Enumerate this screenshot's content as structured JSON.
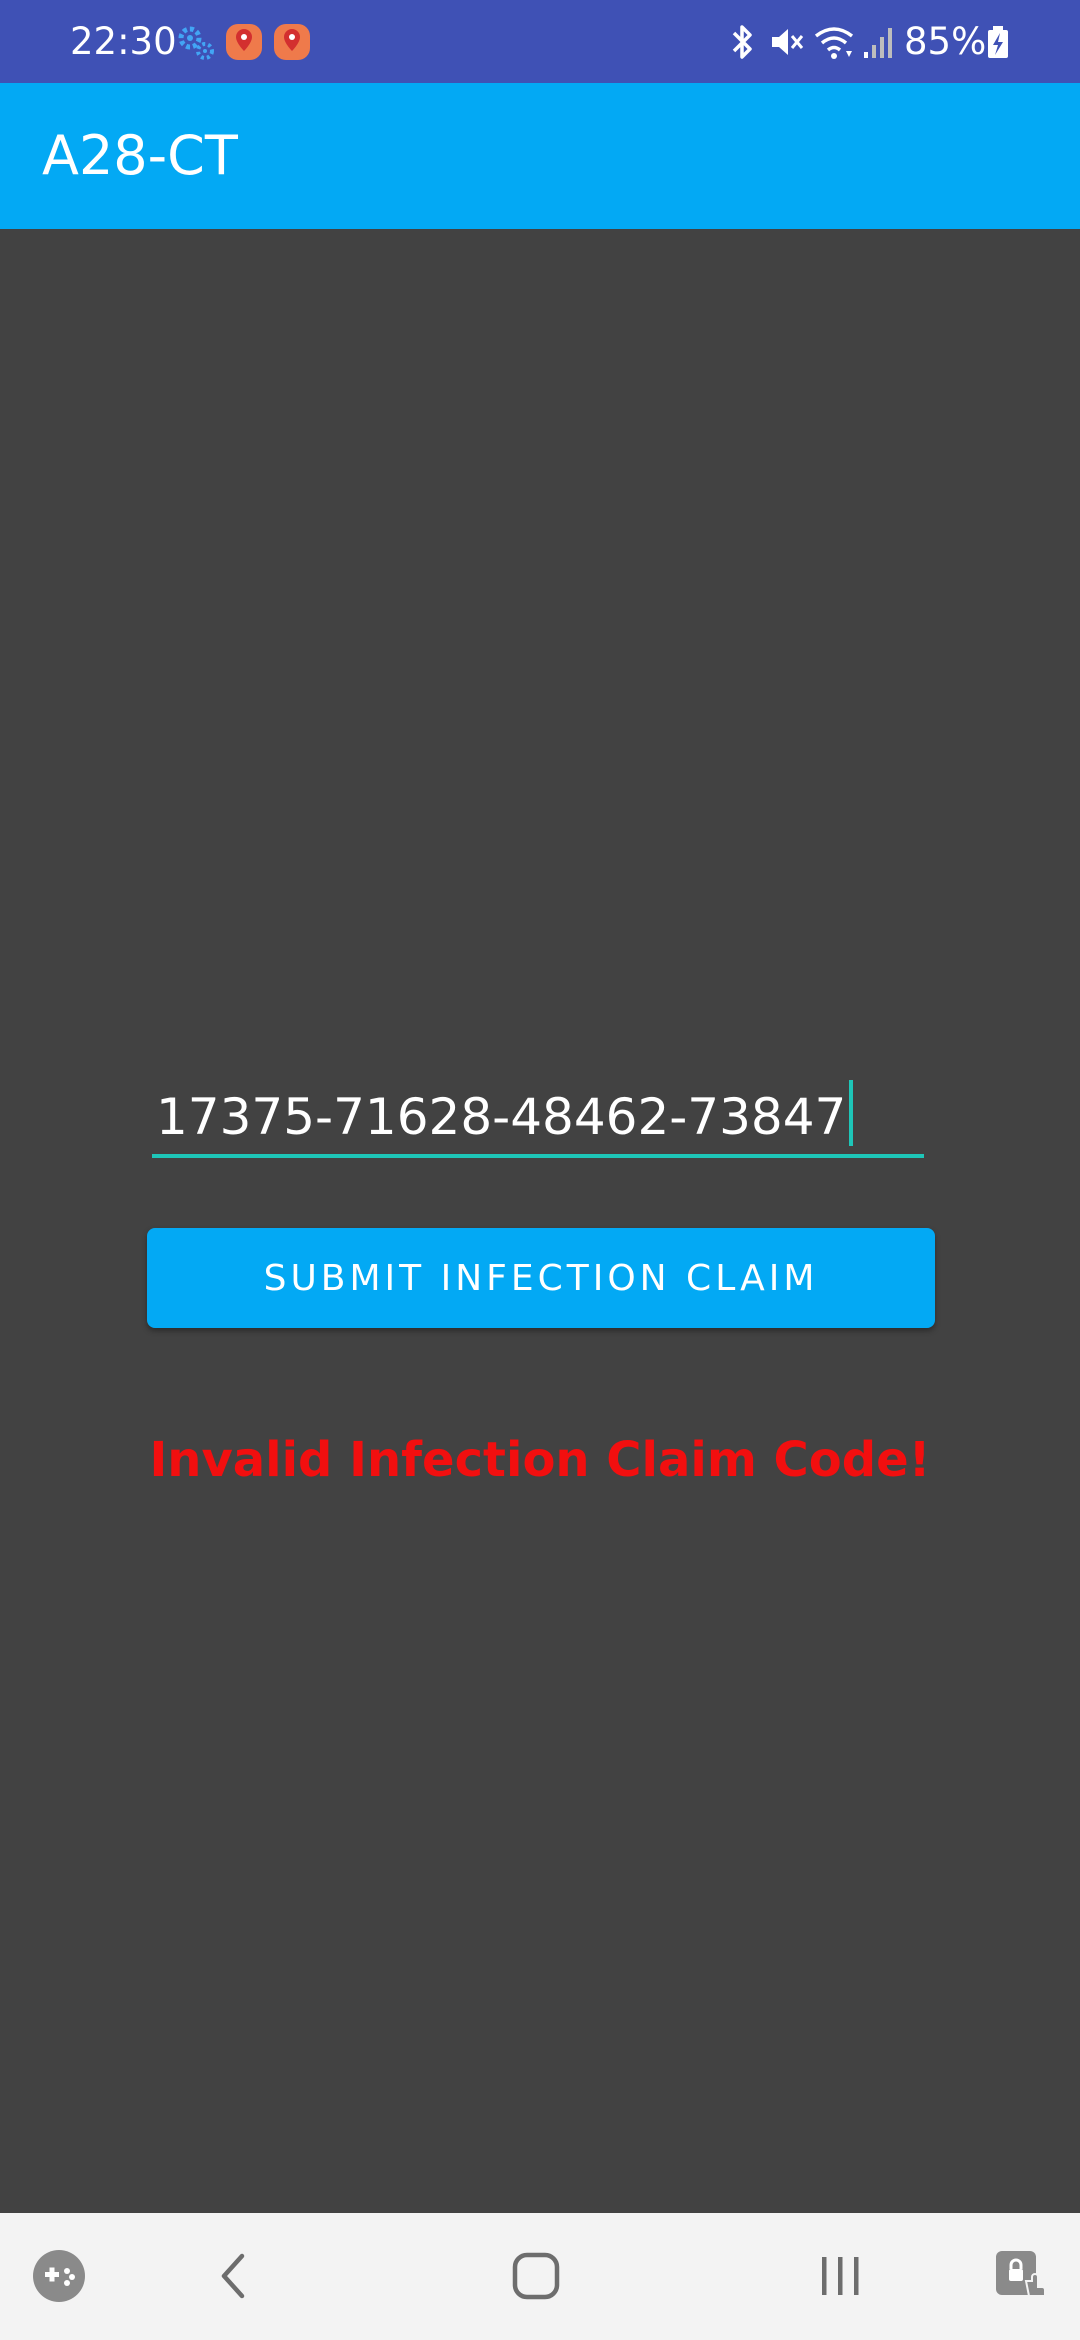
{
  "status_bar": {
    "time": "22:30",
    "battery": "85%",
    "icons": [
      "settings-gear-icon",
      "location-pin-icon",
      "location-pin-icon",
      "bluetooth-icon",
      "mute-icon",
      "wifi-icon",
      "signal-icon",
      "battery-charging-icon"
    ]
  },
  "app_bar": {
    "title": "A28-CT"
  },
  "claim_form": {
    "code_value": "17375-71628-48462-73847",
    "submit_label": "SUBMIT INFECTION CLAIM",
    "error_message": "Invalid Infection Claim Code!"
  },
  "nav_bar": {
    "buttons": [
      "game-tools-icon",
      "back-icon",
      "home-icon",
      "recent-apps-icon",
      "screen-lock-icon"
    ]
  },
  "colors": {
    "status_bar": "#3f51b5",
    "app_bar": "#03a9f4",
    "background": "#424242",
    "accent": "#1ec6b8",
    "error": "#f20f0f"
  }
}
